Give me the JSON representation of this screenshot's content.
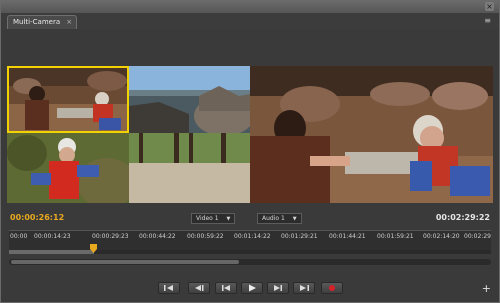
{
  "window": {
    "close_icon": "×"
  },
  "tab": {
    "label": "Multi-Camera",
    "close": "×"
  },
  "panel_menu_icon": "≡",
  "cameras": [
    {
      "id": "camera-1",
      "active": true
    },
    {
      "id": "camera-2",
      "active": false
    },
    {
      "id": "camera-3",
      "active": false
    },
    {
      "id": "camera-4",
      "active": false
    }
  ],
  "timecodes": {
    "current": "00:00:26:12",
    "duration": "00:02:29:22"
  },
  "dropdowns": {
    "video": "Video 1",
    "audio": "Audio 1"
  },
  "ruler_ticks": [
    "00:00",
    "00:00:14:23",
    "00:00:29:23",
    "00:00:44:22",
    "00:00:59:22",
    "00:01:14:22",
    "00:01:29:21",
    "00:01:44:21",
    "00:01:59:21",
    "00:02:14:20",
    "00:02:29"
  ],
  "playhead_fraction": 0.176,
  "colors": {
    "accent": "#e8a91e",
    "active_outline": "#f2d200",
    "record": "#d8202a"
  },
  "controls": [
    {
      "name": "go-to-in-button",
      "icon": "go-to-in-icon"
    },
    {
      "name": "step-back-button",
      "icon": "step-back-icon"
    },
    {
      "name": "play-button",
      "icon": "play-icon"
    },
    {
      "name": "step-forward-button",
      "icon": "step-forward-icon"
    },
    {
      "name": "go-to-out-button",
      "icon": "go-to-out-icon"
    },
    {
      "name": "record-button",
      "icon": "record-icon"
    }
  ],
  "add_button": "+"
}
